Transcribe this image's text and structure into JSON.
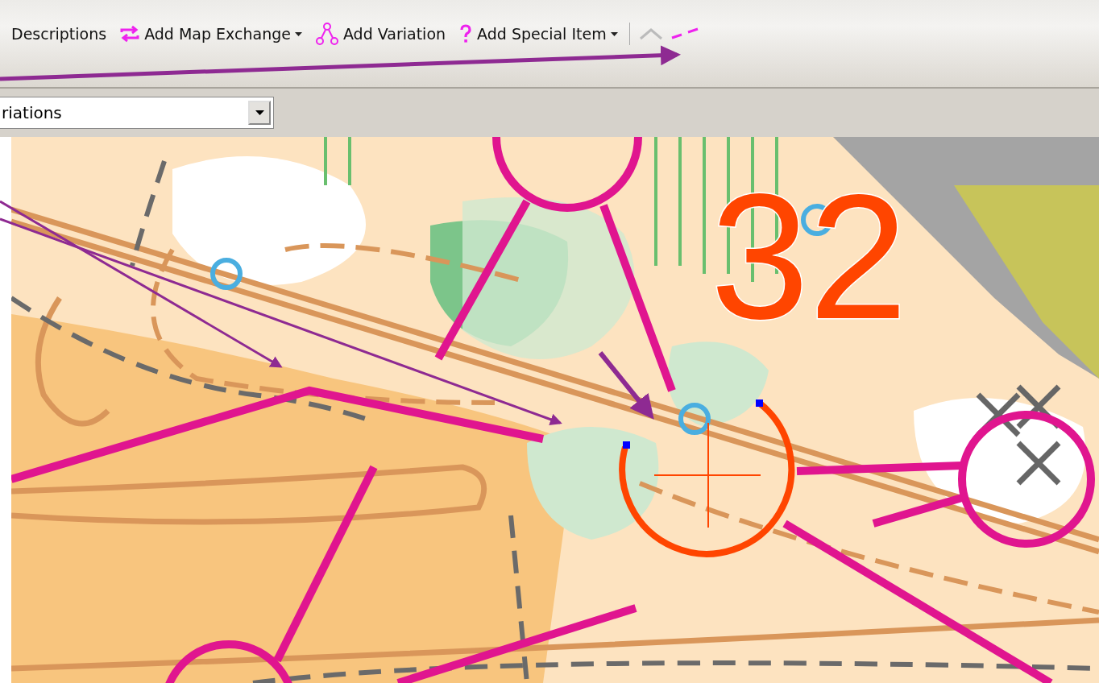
{
  "toolbar": {
    "items": [
      {
        "kind": "button",
        "label": "Descriptions"
      },
      {
        "kind": "dropdown",
        "label": "Add Map Exchange"
      },
      {
        "kind": "button",
        "label": "Add Variation"
      },
      {
        "kind": "dropdown",
        "label": "Add Special Item"
      }
    ],
    "icon_tools": [
      {
        "disabled": true
      },
      {
        "disabled": false
      }
    ]
  },
  "variation_select": {
    "value": "riations"
  },
  "map": {
    "control_number": "32"
  }
}
